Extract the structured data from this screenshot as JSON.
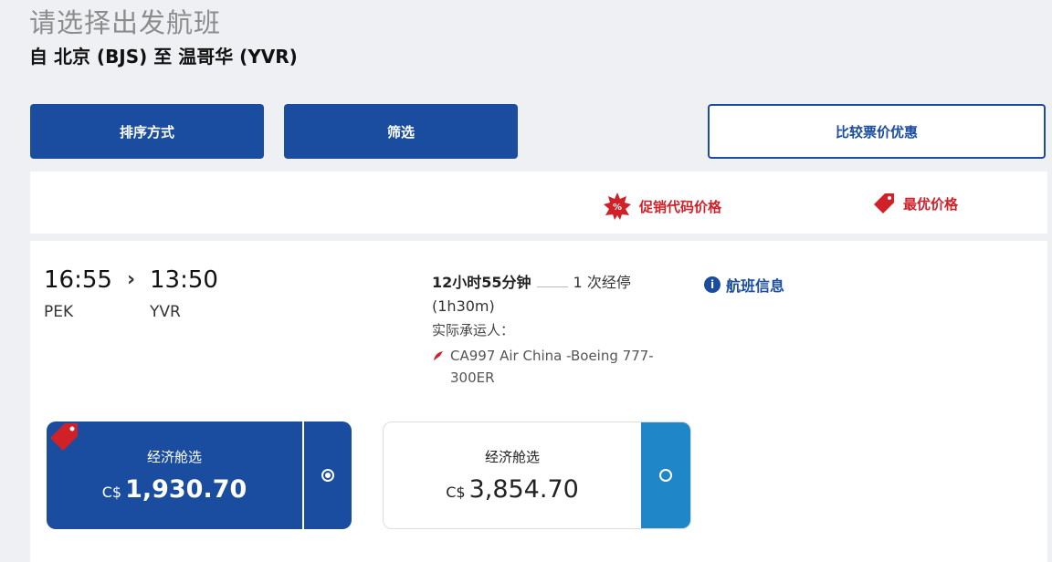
{
  "page": {
    "heading": "请选择出发航班",
    "route": "自 北京 (BJS) 至 温哥华 (YVR)"
  },
  "toolbar": {
    "sort_label": "排序方式",
    "filter_label": "筛选",
    "compare_label": "比较票价优惠"
  },
  "legend": {
    "promo_label": "促销代码价格",
    "lowest_label": "最优价格",
    "promo_color": "#d02028"
  },
  "flight": {
    "departure_time": "16:55",
    "arrival_time": "13:50",
    "arrow": "›",
    "departure_code": "PEK",
    "arrival_code": "YVR",
    "duration": "12小时55分钟",
    "stops": "1 次经停",
    "layover": "(1h30m)",
    "carrier_label": "实际承运人：",
    "carrier_detail": "CA997 Air China -Boeing 777-300ER",
    "info_link": "航班信息",
    "info_icon": "i"
  },
  "fares": [
    {
      "name": "经济舱选",
      "currency": "C$",
      "amount": "1,930.70",
      "selected": true
    },
    {
      "name": "经济舱选",
      "currency": "C$",
      "amount": "3,854.70",
      "selected": false
    }
  ],
  "colors": {
    "brand_blue": "#1a4d9f",
    "accent_blue": "#1f86c8",
    "promo_red": "#d02028"
  }
}
